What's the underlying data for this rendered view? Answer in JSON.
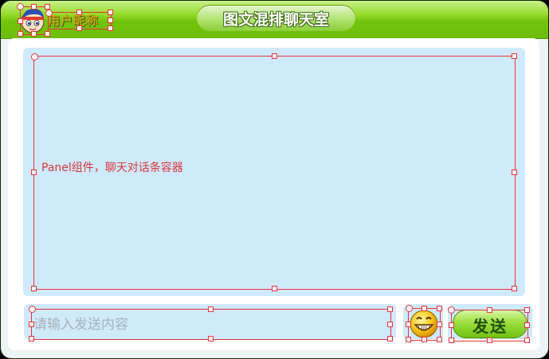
{
  "window": {
    "title": "图文混排聊天室"
  },
  "user": {
    "nickname": "用户昵称",
    "avatar_icon": "cartoon-avatar-icon"
  },
  "chat_panel": {
    "label": "Panel组件，聊天对话条容器"
  },
  "compose": {
    "placeholder": "请输入发送内容",
    "value": "",
    "emoji_icon": "grin-emoji-icon",
    "send_label": "发送"
  },
  "colors": {
    "title_green": "#7ac414",
    "panel_blue": "#cfeafb",
    "selection_red": "#e8323a",
    "label_red": "#d8383a"
  }
}
